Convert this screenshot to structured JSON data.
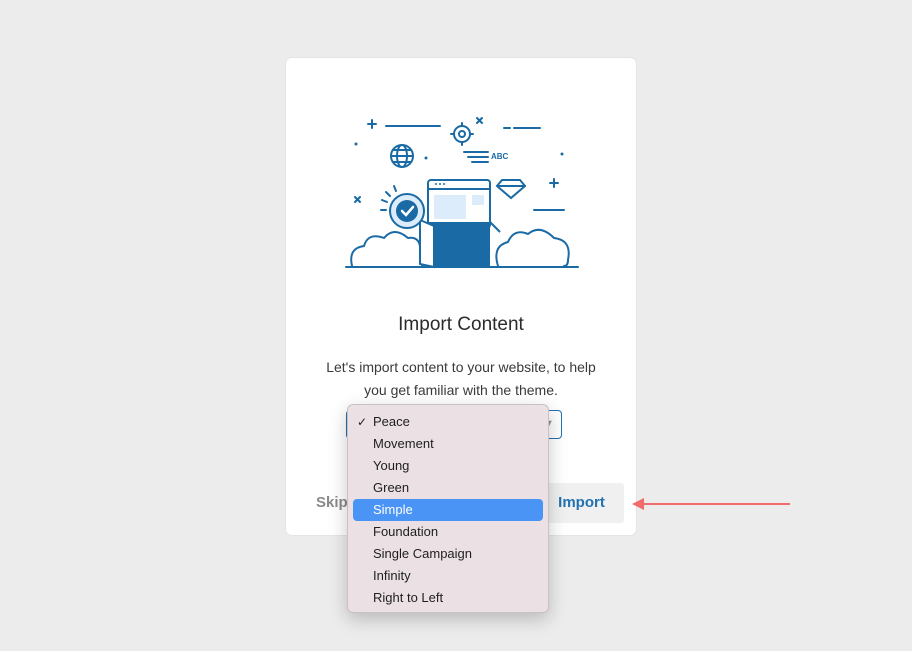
{
  "dialog": {
    "title": "Import Content",
    "description": "Let's import content to your website, to help you get familiar with the theme.",
    "skip_label": "Skip",
    "import_label": "Import",
    "illustration_text": "ABC"
  },
  "dropdown": {
    "selected": "Peace",
    "highlighted": "Simple",
    "options": [
      "Peace",
      "Movement",
      "Young",
      "Green",
      "Simple",
      "Foundation",
      "Single Campaign",
      "Infinity",
      "Right to Left"
    ]
  },
  "colors": {
    "accent": "#2271b1",
    "highlight": "#4a94f5",
    "arrow": "#f26b6b",
    "illustration_blue": "#1a6aa5",
    "illustration_light": "#dcecfa"
  },
  "icons": {
    "check": "checkmark-icon",
    "arrow": "arrow-left-icon",
    "select": "chevron-down-icon"
  }
}
